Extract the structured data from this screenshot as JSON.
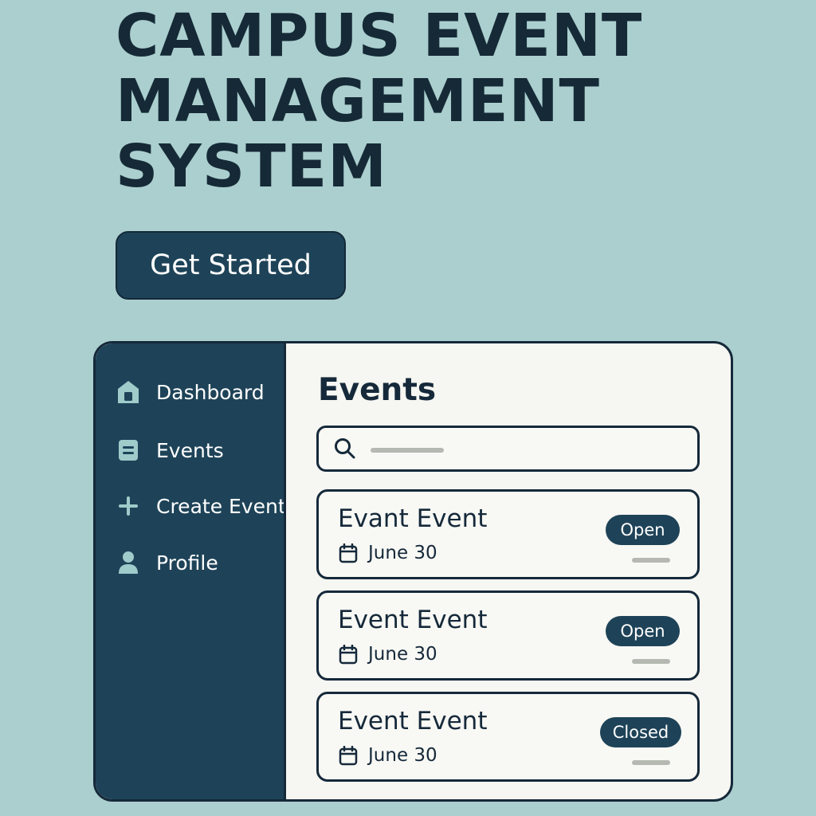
{
  "hero": {
    "title": "CAMPUS EVENT MANAGEMENT SYSTEM",
    "cta_label": "Get Started"
  },
  "sidebar": {
    "items": [
      {
        "label": "Dashboard",
        "icon": "home-icon"
      },
      {
        "label": "Events",
        "icon": "list-icon"
      },
      {
        "label": "Create Event",
        "icon": "plus-icon"
      },
      {
        "label": "Profile",
        "icon": "user-icon"
      }
    ]
  },
  "main": {
    "title": "Events",
    "search": {
      "value": "",
      "placeholder": ""
    }
  },
  "events": [
    {
      "title": "Evant Event",
      "date": "June 30",
      "status": "Open"
    },
    {
      "title": "Event Event",
      "date": "June 30",
      "status": "Open"
    },
    {
      "title": "Event Event",
      "date": "June 30",
      "status": "Closed"
    }
  ],
  "colors": {
    "background": "#abcfcf",
    "primary": "#1e4358",
    "text": "#15293a",
    "panel": "#f6f6f2",
    "muted_bar": "#b6b8b2"
  }
}
